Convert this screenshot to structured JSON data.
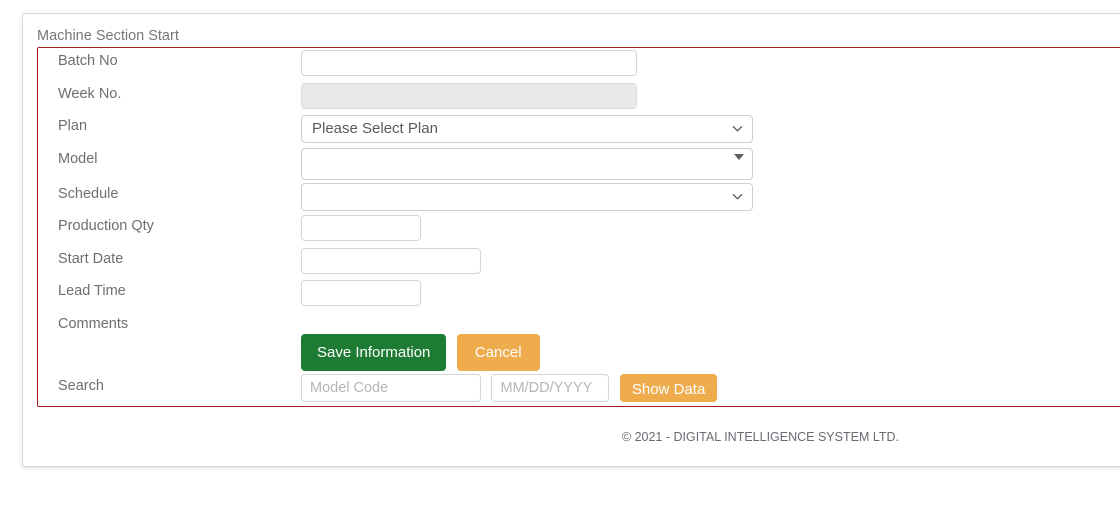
{
  "card": {
    "fieldset_legend": "Machine Section Start",
    "accent_border_color": "#a81c1c"
  },
  "form": {
    "rows": [
      {
        "label": "Batch No",
        "type": "text",
        "value": "",
        "placeholder": ""
      },
      {
        "label": "Week No.",
        "type": "text",
        "value": "",
        "placeholder": "",
        "disabled": true
      },
      {
        "label": "Plan",
        "type": "select",
        "value": "Please Select Plan"
      },
      {
        "label": "Model",
        "type": "combo",
        "value": ""
      },
      {
        "label": "Schedule",
        "type": "select",
        "value": ""
      },
      {
        "label": "Production Qty",
        "type": "text",
        "value": "",
        "placeholder": ""
      },
      {
        "label": "Start Date",
        "type": "text",
        "value": "",
        "placeholder": ""
      },
      {
        "label": "Lead Time",
        "type": "text",
        "value": "",
        "placeholder": ""
      },
      {
        "label": "Comments",
        "type": "none"
      }
    ],
    "labels": {
      "batch_no": "Batch No",
      "week_no": "Week No.",
      "plan": "Plan",
      "model": "Model",
      "schedule": "Schedule",
      "production_qty": "Production Qty",
      "start_date": "Start Date",
      "lead_time": "Lead Time",
      "comments": "Comments",
      "search": "Search"
    },
    "values": {
      "batch_no": "",
      "week_no": "",
      "plan_selected": "Please Select Plan",
      "model_selected": "",
      "schedule_selected": "",
      "production_qty": "",
      "start_date": "",
      "lead_time": ""
    }
  },
  "actions": {
    "save_label": "Save Information",
    "cancel_label": "Cancel",
    "show_data_label": "Show Data",
    "save_color": "#1e7b34",
    "cancel_color": "#eeac4d"
  },
  "search": {
    "model_code_placeholder": "Model Code",
    "model_code_value": "",
    "date_placeholder": "MM/DD/YYYY",
    "date_value": ""
  },
  "footer": {
    "copyright": "© 2021 - DIGITAL INTELLIGENCE SYSTEM LTD."
  }
}
